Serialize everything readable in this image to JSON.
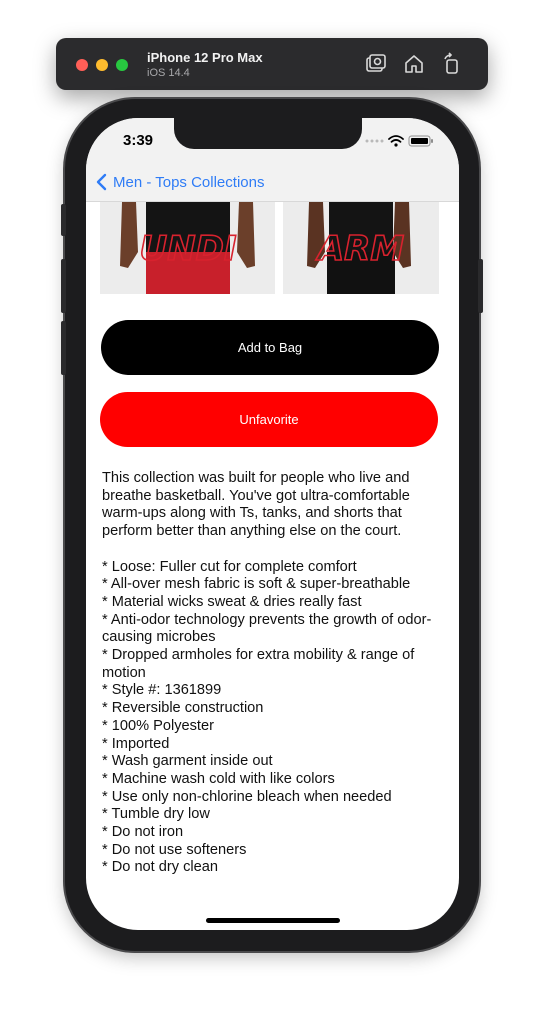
{
  "simulator": {
    "device_name": "iPhone 12 Pro Max",
    "os_version": "iOS 14.4"
  },
  "status_bar": {
    "time": "3:39"
  },
  "nav": {
    "back_label": "Men - Tops Collections"
  },
  "product_images": [
    {
      "overlay_text": "UNDI",
      "shorts_color": "#c8202b"
    },
    {
      "overlay_text": "ARM",
      "shorts_color": "#111111"
    }
  ],
  "buttons": {
    "add_to_bag": "Add to Bag",
    "unfavorite": "Unfavorite"
  },
  "description": {
    "intro": "This collection was built for people who live and breathe basketball. You've got ultra-comfortable warm-ups along with Ts, tanks, and shorts that perform better than anything else on the court.",
    "bullets": [
      "* Loose: Fuller cut for complete comfort",
      "* All-over mesh fabric is soft & super-breathable",
      "* Material wicks sweat & dries really fast",
      "* Anti-odor technology prevents the growth of odor-causing microbes",
      "* Dropped armholes for extra mobility & range of motion",
      "* Style #: 1361899",
      "* Reversible construction",
      "* 100% Polyester",
      "* Imported",
      "* Wash garment inside out",
      "* Machine wash cold with like colors",
      "* Use only non-chlorine bleach when needed",
      "* Tumble dry low",
      "* Do not iron",
      "* Do not use softeners",
      "* Do not dry clean"
    ]
  },
  "colors": {
    "link_blue": "#2f7cf6",
    "primary_black": "#000000",
    "unfavorite_red": "#ff0000"
  }
}
